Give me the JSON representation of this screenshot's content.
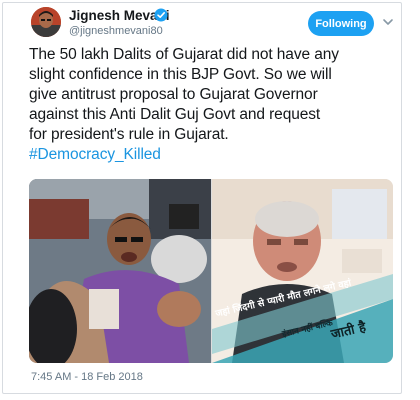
{
  "author": {
    "display_name": "Jignesh Mevani",
    "handle": "@jigneshmevani80",
    "verified": true,
    "verified_icon": "verified-badge-icon",
    "avatar_icon": "avatar"
  },
  "actions": {
    "follow_label": "Following",
    "menu_icon": "chevron-down-icon"
  },
  "tweet": {
    "lines": [
      "The 50 lakh Dalits of Gujarat did not have any",
      "slight confidence in this BJP Govt. So we will",
      "give antitrust proposal to Gujarat Governor",
      "against this Anti Dalit Guj Govt and request",
      "for president's rule in Gujarat."
    ],
    "hashtag": "#Democracy_Killed"
  },
  "media": {
    "overlay_text_1": "जहां जिंदगी से प्यारी मौत लगने लगे वहां",
    "overlay_text_2": "इंसान नहीं बल्कि",
    "overlay_text_3": "जाती है"
  },
  "timestamp": "7:45 AM - 18 Feb 2018",
  "colors": {
    "accent": "#1da1f2",
    "hashtag": "#1b95e0",
    "secondary_text": "#657786"
  }
}
